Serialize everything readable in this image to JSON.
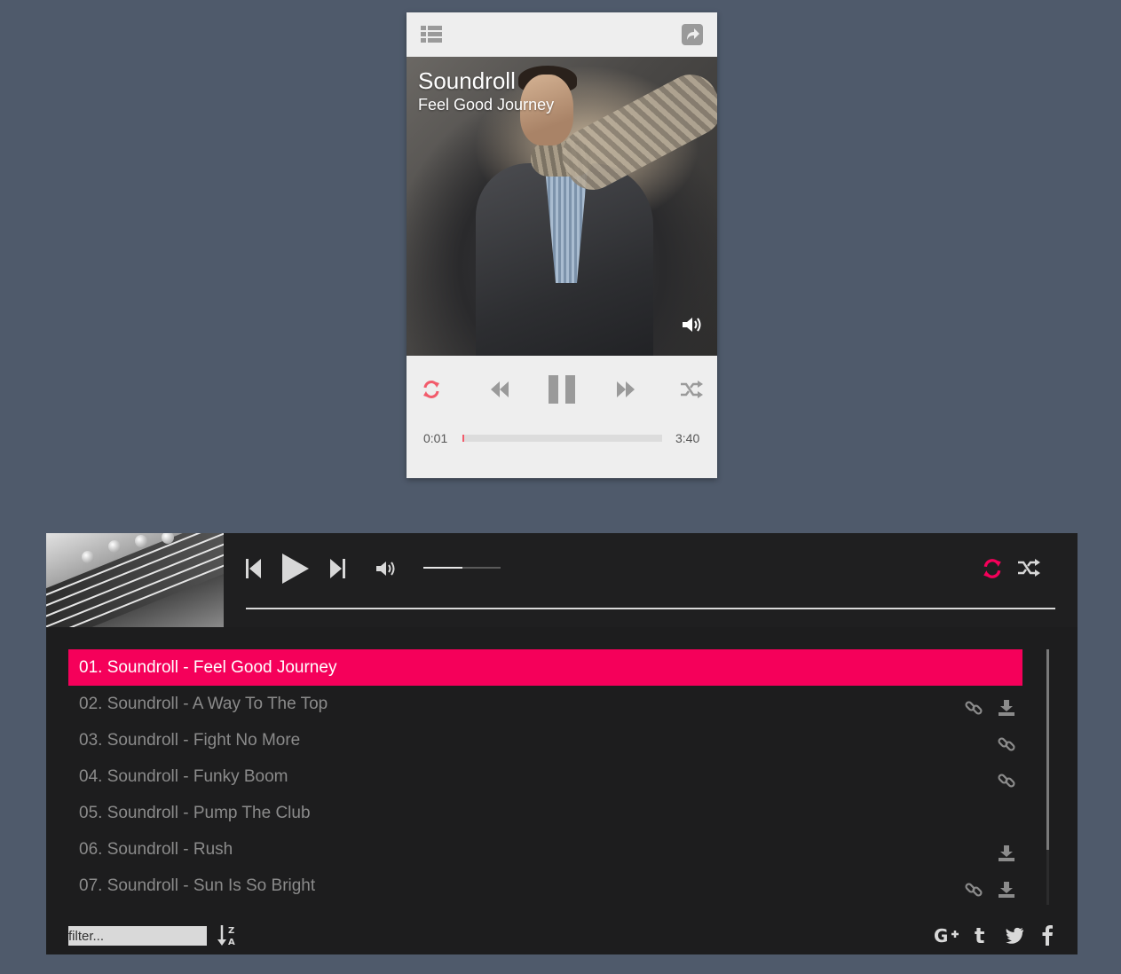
{
  "compact_player": {
    "title": "Soundroll",
    "subtitle": "Feel Good Journey",
    "time_current": "0:01",
    "time_total": "3:40",
    "progress": 0.005,
    "icons": {
      "playlist": "list-icon",
      "share": "share-icon",
      "volume": "volume-icon",
      "repeat": "repeat-icon",
      "rewind": "rewind-icon",
      "pause": "pause-icon",
      "forward": "fast-forward-icon",
      "shuffle": "shuffle-icon"
    },
    "colors": {
      "accent": "#f25b6b",
      "panel": "#eeeeee",
      "icon": "#9a9a9a"
    }
  },
  "full_player": {
    "volume_level": 0.5,
    "icons": {
      "prev": "skip-previous-icon",
      "play": "play-icon",
      "next": "skip-next-icon",
      "volume": "volume-icon",
      "repeat": "repeat-icon",
      "shuffle": "shuffle-icon",
      "sort": "sort-alpha-icon",
      "google_plus": "google-plus-icon",
      "tumblr": "tumblr-icon",
      "twitter": "twitter-icon",
      "facebook": "facebook-icon",
      "link": "link-icon",
      "download": "download-icon"
    },
    "colors": {
      "accent": "#f5005a",
      "background": "#1d1d1e",
      "text": "#8b8b8b"
    },
    "playlist": [
      {
        "label": "01. Soundroll - Feel Good Journey",
        "active": true,
        "link": false,
        "download": false
      },
      {
        "label": "02. Soundroll - A Way To The Top",
        "active": false,
        "link": true,
        "download": true
      },
      {
        "label": "03. Soundroll - Fight No More",
        "active": false,
        "link": true,
        "download": false
      },
      {
        "label": "04. Soundroll - Funky Boom",
        "active": false,
        "link": true,
        "download": false
      },
      {
        "label": "05. Soundroll - Pump The Club",
        "active": false,
        "link": false,
        "download": false
      },
      {
        "label": "06. Soundroll - Rush",
        "active": false,
        "link": false,
        "download": true
      },
      {
        "label": "07. Soundroll - Sun Is So Bright",
        "active": false,
        "link": true,
        "download": true
      }
    ],
    "filter": {
      "placeholder": "filter..."
    }
  }
}
